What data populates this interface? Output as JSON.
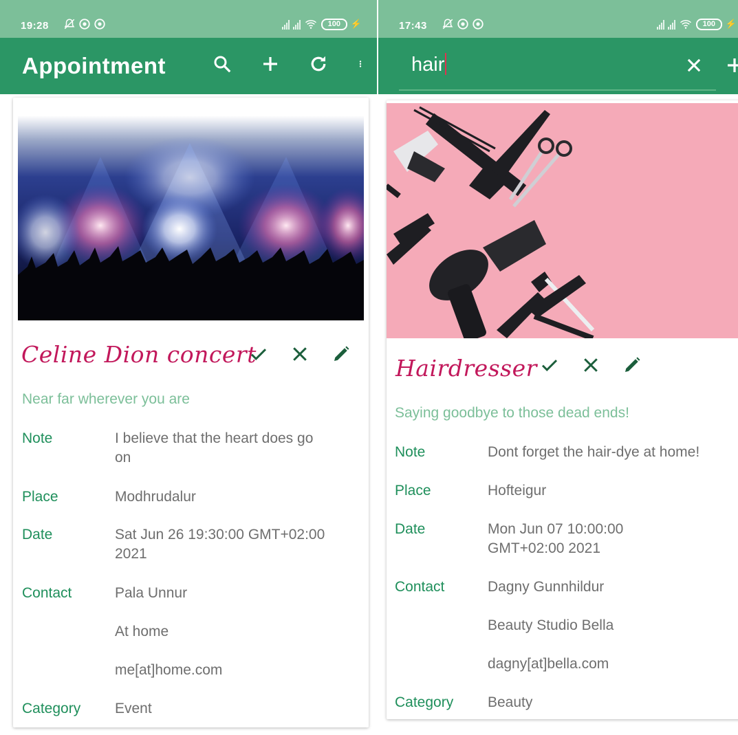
{
  "left": {
    "status": {
      "time": "19:28",
      "battery": "100"
    },
    "appbar": {
      "title": "Appointment"
    },
    "card": {
      "title": "Celine Dion concert",
      "subtitle": "Near far wherever you are",
      "note_label": "Note",
      "note_line1": "I believe that the heart does go",
      "note_line2": "on",
      "place_label": "Place",
      "place": "Modhrudalur",
      "date_label": "Date",
      "date_line1": "Sat Jun 26 19:30:00 GMT+02:00",
      "date_line2": "2021",
      "contact_label": "Contact",
      "contact_name": "Pala Unnur",
      "contact_company": "At home",
      "contact_email": "me[at]home.com",
      "category_label": "Category",
      "category": "Event"
    }
  },
  "right": {
    "status": {
      "time": "17:43",
      "battery": "100"
    },
    "search": {
      "query": "hair"
    },
    "card": {
      "title": "Hairdresser",
      "subtitle": "Saying goodbye to those dead ends!",
      "note_label": "Note",
      "note": "Dont forget the hair-dye at home!",
      "place_label": "Place",
      "place": "Hofteigur",
      "date_label": "Date",
      "date_line1": "Mon Jun 07 10:00:00",
      "date_line2": "GMT+02:00 2021",
      "contact_label": "Contact",
      "contact_name": "Dagny Gunnhildur",
      "contact_company": "Beauty Studio Bella",
      "contact_email": "dagny[at]bella.com",
      "category_label": "Category",
      "category": "Beauty"
    }
  },
  "colors": {
    "statusbar": "#7cbf99",
    "appbar": "#2b9665",
    "title_pink": "#c2185b",
    "label_green": "#1f8f5b",
    "subtitle_green": "#7cbf99",
    "value_gray": "#6e6e6e",
    "action_green": "#1b5e3b"
  },
  "icons": [
    "search-icon",
    "add-icon",
    "refresh-icon",
    "more-vert-icon",
    "close-icon",
    "check-icon",
    "edit-icon",
    "mute-icon",
    "wifi-icon",
    "battery-icon"
  ]
}
